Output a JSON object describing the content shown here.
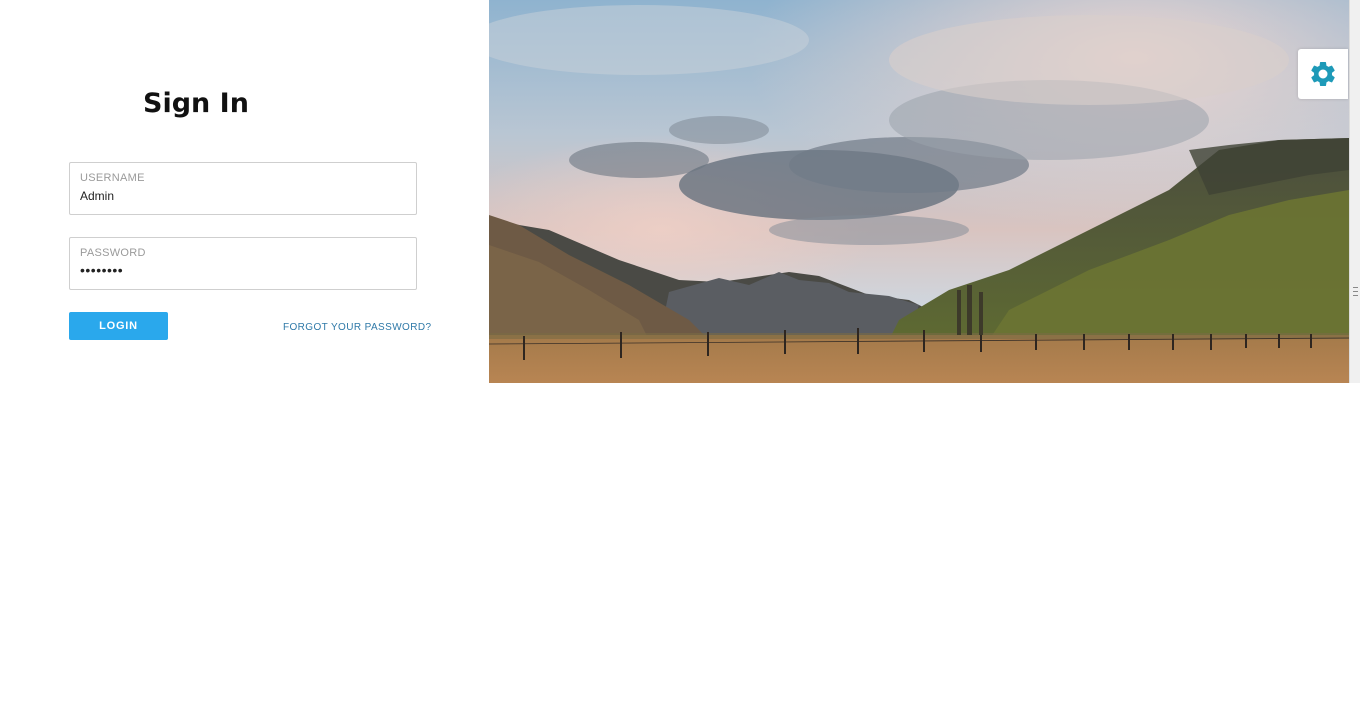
{
  "login": {
    "title": "Sign In",
    "username_label": "USERNAME",
    "username_value": "Admin",
    "password_label": "PASSWORD",
    "password_value": "••••••••",
    "login_button": "LOGIN",
    "forgot_link": "FORGOT YOUR PASSWORD?"
  },
  "hero": {
    "icon": "mountain-landscape-image"
  },
  "settings": {
    "icon": "gear-icon",
    "color": "#1e9ab8"
  },
  "colors": {
    "accent": "#2aa8ec",
    "link": "#2f79a8"
  }
}
